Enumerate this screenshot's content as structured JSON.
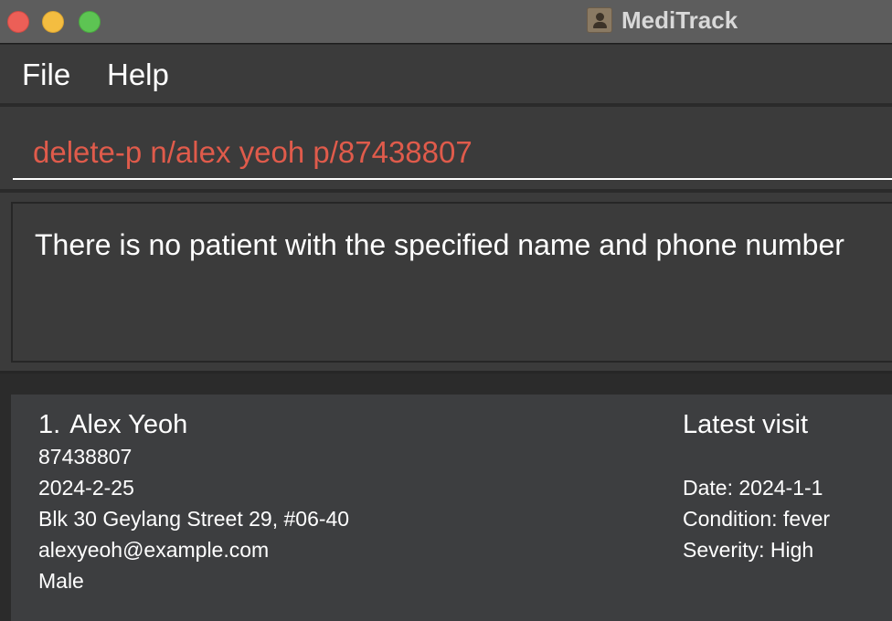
{
  "window": {
    "title": "MediTrack"
  },
  "menu": {
    "file_label": "File",
    "help_label": "Help"
  },
  "command": {
    "value": "delete-p n/alex yeoh p/87438807",
    "text_color": "#e05b4b"
  },
  "result": {
    "message": "There is no patient with the specified name and phone number"
  },
  "patients": [
    {
      "index": "1.",
      "name": "Alex Yeoh",
      "phone": "87438807",
      "dob": "2024-2-25",
      "address": "Blk 30 Geylang Street 29, #06-40",
      "email": "alexyeoh@example.com",
      "gender": "Male",
      "visit": {
        "heading": "Latest visit",
        "date": "Date: 2024-1-1",
        "condition": "Condition: fever",
        "severity": "Severity: High"
      }
    }
  ]
}
